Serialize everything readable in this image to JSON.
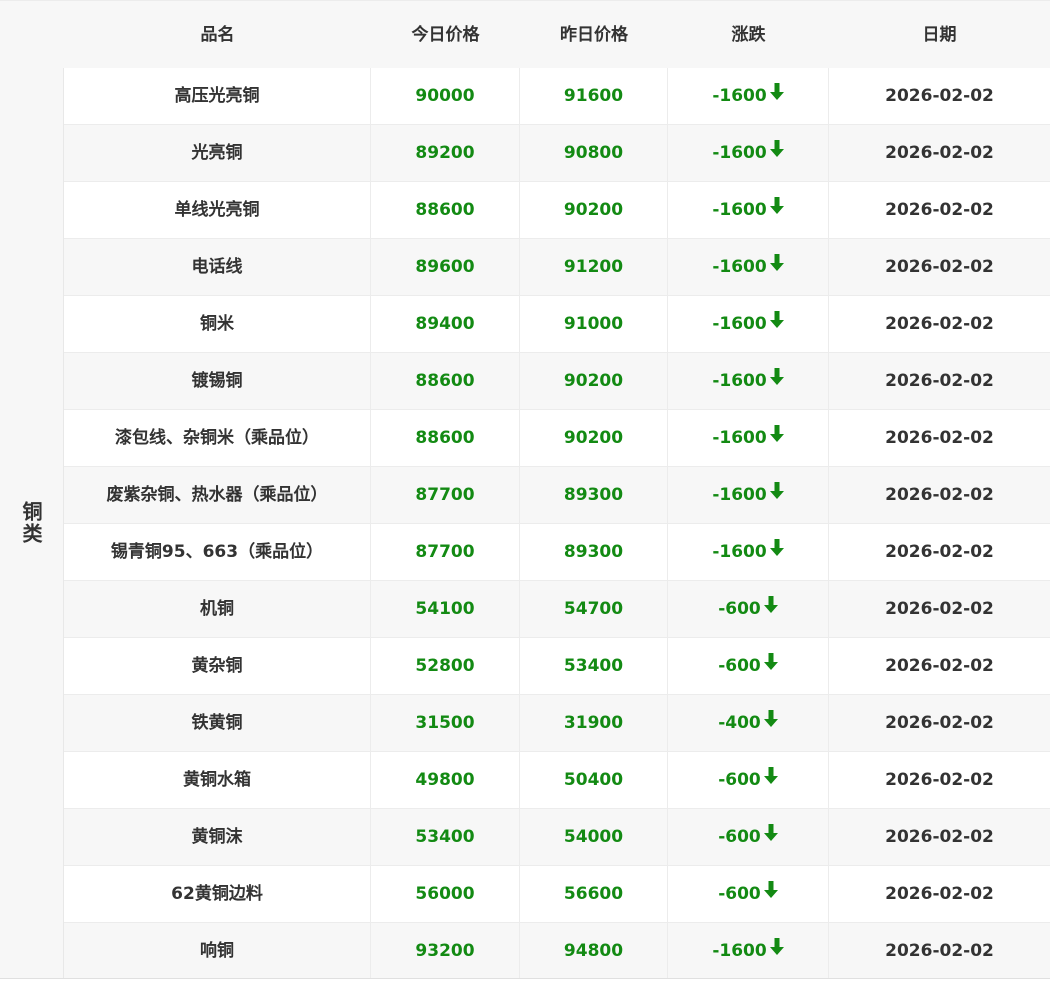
{
  "header": {
    "col_name": "品名",
    "col_today": "今日价格",
    "col_yesterday": "昨日价格",
    "col_change": "涨跌",
    "col_date": "日期"
  },
  "category": "铜类",
  "colors": {
    "price_green": "#138a13",
    "text_dark": "#333333",
    "header_bg": "#f7f7f7"
  },
  "rows": [
    {
      "name": "高压光亮铜",
      "today": "90000",
      "yesterday": "91600",
      "change": "-1600",
      "date": "2026-02-02"
    },
    {
      "name": "光亮铜",
      "today": "89200",
      "yesterday": "90800",
      "change": "-1600",
      "date": "2026-02-02"
    },
    {
      "name": "单线光亮铜",
      "today": "88600",
      "yesterday": "90200",
      "change": "-1600",
      "date": "2026-02-02"
    },
    {
      "name": "电话线",
      "today": "89600",
      "yesterday": "91200",
      "change": "-1600",
      "date": "2026-02-02"
    },
    {
      "name": "铜米",
      "today": "89400",
      "yesterday": "91000",
      "change": "-1600",
      "date": "2026-02-02"
    },
    {
      "name": "镀锡铜",
      "today": "88600",
      "yesterday": "90200",
      "change": "-1600",
      "date": "2026-02-02"
    },
    {
      "name": "漆包线、杂铜米（乘品位）",
      "today": "88600",
      "yesterday": "90200",
      "change": "-1600",
      "date": "2026-02-02"
    },
    {
      "name": "废紫杂铜、热水器（乘品位）",
      "today": "87700",
      "yesterday": "89300",
      "change": "-1600",
      "date": "2026-02-02"
    },
    {
      "name": "锡青铜95、663（乘品位）",
      "today": "87700",
      "yesterday": "89300",
      "change": "-1600",
      "date": "2026-02-02"
    },
    {
      "name": "机铜",
      "today": "54100",
      "yesterday": "54700",
      "change": "-600",
      "date": "2026-02-02"
    },
    {
      "name": "黄杂铜",
      "today": "52800",
      "yesterday": "53400",
      "change": "-600",
      "date": "2026-02-02"
    },
    {
      "name": "铁黄铜",
      "today": "31500",
      "yesterday": "31900",
      "change": "-400",
      "date": "2026-02-02"
    },
    {
      "name": "黄铜水箱",
      "today": "49800",
      "yesterday": "50400",
      "change": "-600",
      "date": "2026-02-02"
    },
    {
      "name": "黄铜沫",
      "today": "53400",
      "yesterday": "54000",
      "change": "-600",
      "date": "2026-02-02"
    },
    {
      "name": "62黄铜边料",
      "today": "56000",
      "yesterday": "56600",
      "change": "-600",
      "date": "2026-02-02"
    },
    {
      "name": "响铜",
      "today": "93200",
      "yesterday": "94800",
      "change": "-1600",
      "date": "2026-02-02"
    }
  ]
}
